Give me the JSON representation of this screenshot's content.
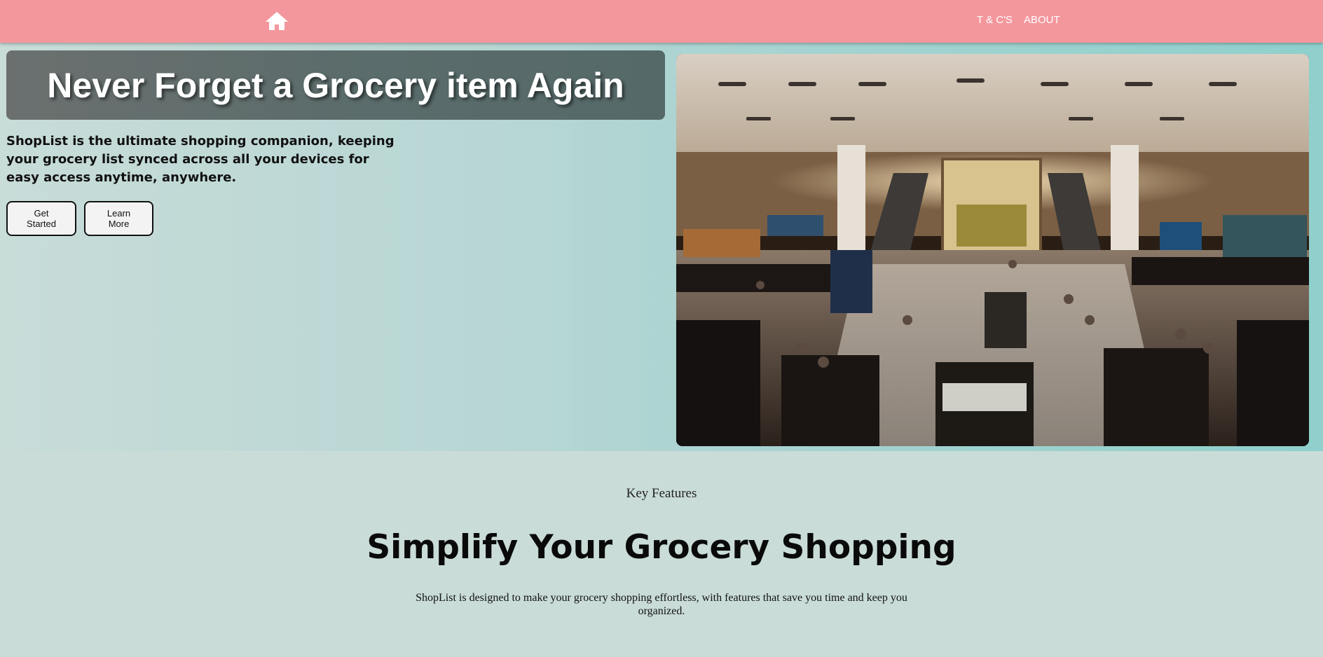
{
  "colors": {
    "navbar_bg": "#f4979d",
    "hero_title_bg": "#5a6c6b",
    "page_bg": "#c9dcd8",
    "hero_accent": "#8fd0cc"
  },
  "navbar": {
    "home_icon": "home-icon",
    "links": [
      {
        "label": "T & C'S"
      },
      {
        "label": "ABOUT"
      }
    ]
  },
  "hero": {
    "title": "Never Forget a Grocery item Again",
    "description": "ShopList is the ultimate shopping companion, keeping your grocery list synced across all your devices for easy access anytime, anywhere.",
    "buttons": {
      "get_started": "Get Started",
      "learn_more": "Learn More"
    },
    "image": "department-store-interior-photo"
  },
  "features": {
    "eyebrow": "Key Features",
    "heading": "Simplify Your Grocery Shopping",
    "description": "ShopList is designed to make your grocery shopping effortless, with features that save you time and keep you organized."
  }
}
